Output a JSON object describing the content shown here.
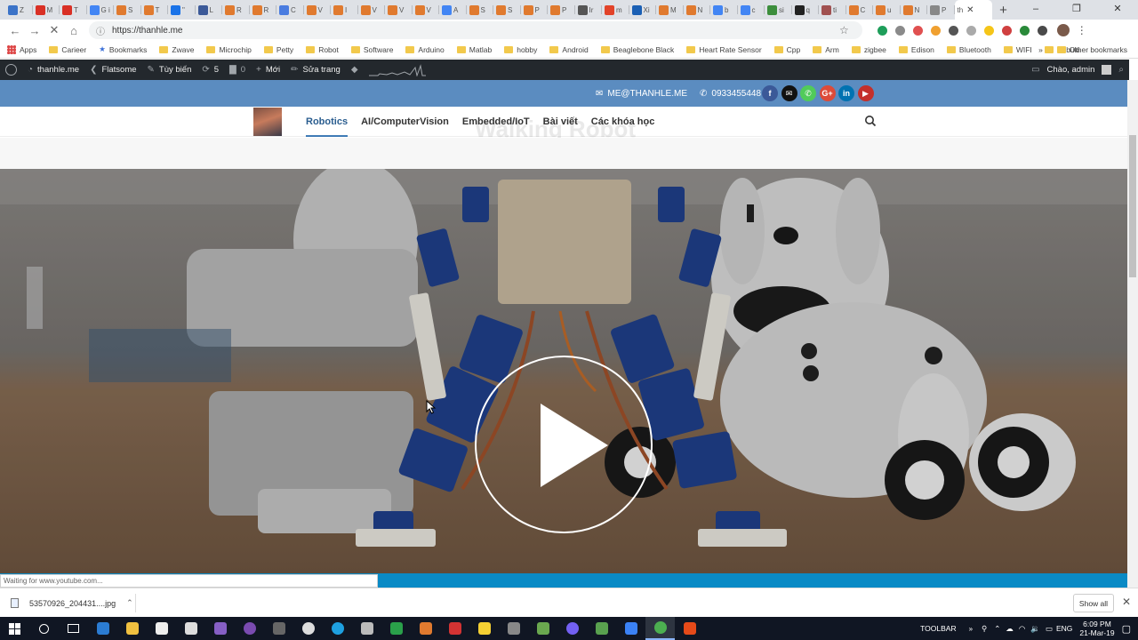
{
  "browser": {
    "tabs": [
      {
        "label": "Z",
        "color": "#3b73c8"
      },
      {
        "label": "M",
        "color": "#d93025"
      },
      {
        "label": "T",
        "color": "#d93025"
      },
      {
        "label": "G i",
        "color": "#4285f4"
      },
      {
        "label": "S",
        "color": "#e07a2f"
      },
      {
        "label": "T",
        "color": "#e07a2f"
      },
      {
        "label": "\"",
        "color": "#1a73e8"
      },
      {
        "label": "L",
        "color": "#3b5998"
      },
      {
        "label": "R",
        "color": "#e07a2f"
      },
      {
        "label": "R",
        "color": "#e07a2f"
      },
      {
        "label": "C",
        "color": "#4a7ce0"
      },
      {
        "label": "V",
        "color": "#e07a2f"
      },
      {
        "label": "I",
        "color": "#e07a2f"
      },
      {
        "label": "V",
        "color": "#e07a2f"
      },
      {
        "label": "V",
        "color": "#e07a2f"
      },
      {
        "label": "V",
        "color": "#e07a2f"
      },
      {
        "label": "A",
        "color": "#4285f4"
      },
      {
        "label": "S",
        "color": "#e07a2f"
      },
      {
        "label": "S",
        "color": "#e07a2f"
      },
      {
        "label": "P",
        "color": "#e07a2f"
      },
      {
        "label": "P",
        "color": "#e07a2f"
      },
      {
        "label": "Ir",
        "color": "#555555"
      },
      {
        "label": "m",
        "color": "#e24329"
      },
      {
        "label": "Xi",
        "color": "#1a5fb4"
      },
      {
        "label": "M",
        "color": "#e07a2f"
      },
      {
        "label": "N",
        "color": "#e07a2f"
      },
      {
        "label": "b",
        "color": "#4285f4"
      },
      {
        "label": "c",
        "color": "#4285f4"
      },
      {
        "label": "si",
        "color": "#3c8e3c"
      },
      {
        "label": "q",
        "color": "#222222"
      },
      {
        "label": "ti",
        "color": "#a05050"
      },
      {
        "label": "C",
        "color": "#e07a2f"
      },
      {
        "label": "u",
        "color": "#e07a2f"
      },
      {
        "label": "N",
        "color": "#e07a2f"
      },
      {
        "label": "P",
        "color": "#888888"
      }
    ],
    "active_tab": {
      "label": "th",
      "close": "✕"
    },
    "new_tab": "+",
    "window_controls": {
      "minimize": "–",
      "maximize": "❐",
      "close": "✕"
    },
    "url": "https://thanhle.me",
    "extension_colors": [
      "#1e9e5a",
      "#8a8a8a",
      "#e05050",
      "#f0a030",
      "#555555",
      "#aaaaaa",
      "#f5c518",
      "#d04040",
      "#2a8a3a",
      "#4a4a4a"
    ],
    "bookmarks": [
      "Apps",
      "Carieer",
      "Bookmarks",
      "Zwave",
      "Microchip",
      "Petty",
      "Robot",
      "Software",
      "Arduino",
      "Matlab",
      "hobby",
      "Android",
      "Beaglebone Black",
      "Heart Rate Sensor",
      "Cpp",
      "Arm",
      "zigbee",
      "Edison",
      "Bluetooth",
      "WIFI",
      "Kobuki"
    ],
    "bookmarks_more": "»",
    "other_bookmarks": "Other bookmarks"
  },
  "wp_admin_bar": {
    "site_name": "thanhle.me",
    "theme": "Flatsome",
    "customize": "Tùy biến",
    "updates": "5",
    "comments": "0",
    "new": "Mới",
    "edit_page": "Sửa trang",
    "greeting": "Chào, admin"
  },
  "site": {
    "email": "ME@THANHLE.ME",
    "phone": "0933455448",
    "socials": [
      {
        "name": "facebook",
        "glyph": "f",
        "color": "#3b5998"
      },
      {
        "name": "email",
        "glyph": "✉",
        "color": "#111111"
      },
      {
        "name": "phone",
        "glyph": "✆",
        "color": "#51cb5a"
      },
      {
        "name": "google-plus",
        "glyph": "G+",
        "color": "#dd4b39"
      },
      {
        "name": "linkedin",
        "glyph": "in",
        "color": "#0072b1"
      },
      {
        "name": "youtube",
        "glyph": "▶",
        "color": "#c4302b"
      }
    ],
    "nav": [
      "Robotics",
      "AI/ComputerVision",
      "Embedded/IoT",
      "Bài viết",
      "Các khóa học"
    ],
    "nav_active": 0,
    "ghost_heading": "Walking Robot"
  },
  "status_text": "Waiting for www.youtube.com...",
  "downloads": {
    "file_name": "53570926_204431....jpg",
    "show_all": "Show all"
  },
  "taskbar": {
    "apps": [
      {
        "name": "edge",
        "color": "#2b7cd3"
      },
      {
        "name": "file-explorer",
        "color": "#f0c040"
      },
      {
        "name": "mail",
        "color": "#eeeeee"
      },
      {
        "name": "store",
        "color": "#dddddd"
      },
      {
        "name": "visual-studio",
        "color": "#865fc5"
      },
      {
        "name": "app-purple",
        "color": "#7a4bb0"
      },
      {
        "name": "app-gray",
        "color": "#666666"
      },
      {
        "name": "emoji",
        "color": "#dddddd"
      },
      {
        "name": "internet-explorer",
        "color": "#1ea0e0"
      },
      {
        "name": "app-calc",
        "color": "#bbbbbb"
      },
      {
        "name": "app-tree",
        "color": "#2aa04a"
      },
      {
        "name": "matlab",
        "color": "#e07a2f"
      },
      {
        "name": "app-red",
        "color": "#d33333"
      },
      {
        "name": "sticky-notes",
        "color": "#f5d033"
      },
      {
        "name": "app-gear",
        "color": "#888888"
      },
      {
        "name": "app-frog",
        "color": "#6aa84f"
      },
      {
        "name": "viber",
        "color": "#7360f2"
      },
      {
        "name": "app-green",
        "color": "#59a14f"
      },
      {
        "name": "app-blue",
        "color": "#3b82f6"
      },
      {
        "name": "chrome",
        "color": "#4caf50"
      },
      {
        "name": "app-orange",
        "color": "#e64a19"
      }
    ],
    "active_app": 19,
    "toolbar_label": "TOOLBAR",
    "lang": "ENG",
    "time": "6:09 PM",
    "date": "21-Mar-19"
  }
}
